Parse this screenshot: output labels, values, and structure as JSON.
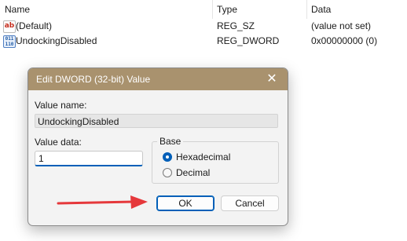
{
  "registry": {
    "columns": {
      "name": "Name",
      "type": "Type",
      "data": "Data"
    },
    "rows": [
      {
        "icon": "string-value-icon",
        "icon_glyph": "ab",
        "name": "(Default)",
        "type": "REG_SZ",
        "data": "(value not set)"
      },
      {
        "icon": "binary-value-icon",
        "icon_glyph": "011 110",
        "name": "UndockingDisabled",
        "type": "REG_DWORD",
        "data": "0x00000000 (0)"
      }
    ]
  },
  "dialog": {
    "title": "Edit DWORD (32-bit) Value",
    "close_glyph": "✕",
    "value_name_label": "Value name:",
    "value_name": "UndockingDisabled",
    "value_data_label": "Value data:",
    "value_data": "1",
    "base_label": "Base",
    "base_options": [
      {
        "label": "Hexadecimal",
        "checked": true
      },
      {
        "label": "Decimal",
        "checked": false
      }
    ],
    "ok_label": "OK",
    "cancel_label": "Cancel"
  },
  "colors": {
    "title_bar": "#a9926e",
    "accent": "#005fb8",
    "annotation_arrow": "#e5383b"
  }
}
